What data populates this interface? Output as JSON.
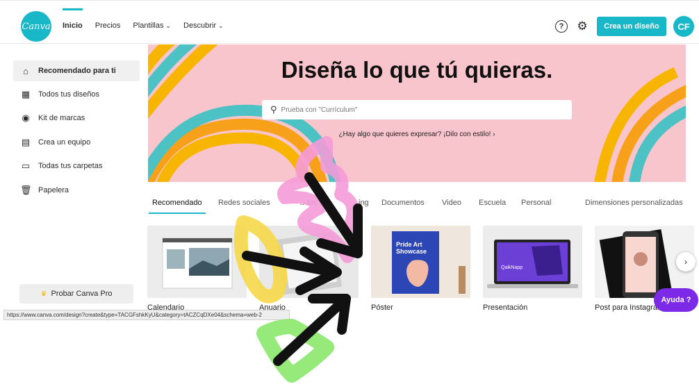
{
  "header": {
    "logo_text": "Canva",
    "nav": [
      {
        "label": "Inicio"
      },
      {
        "label": "Precios"
      },
      {
        "label": "Plantillas",
        "has_dropdown": true
      },
      {
        "label": "Descubrir",
        "has_dropdown": true
      }
    ],
    "create_button": "Crea un diseño",
    "avatar_initials": "CF",
    "help_icon": "?"
  },
  "sidebar": {
    "items": [
      {
        "label": "Recomendado para ti",
        "icon": "home-icon"
      },
      {
        "label": "Todos tus diseños",
        "icon": "grid-icon"
      },
      {
        "label": "Kit de marcas",
        "icon": "brand-kit-icon"
      },
      {
        "label": "Crea un equipo",
        "icon": "team-icon"
      },
      {
        "label": "Todas tus carpetas",
        "icon": "folder-icon"
      },
      {
        "label": "Papelera",
        "icon": "trash-icon"
      }
    ],
    "pro_button": "Probar Canva Pro"
  },
  "hero": {
    "title": "Diseña lo que tú quieras.",
    "search_placeholder": "Prueba con \"Currículum\"",
    "link": "¿Hay algo que quieres expresar? ¡Dilo con estilo! ›"
  },
  "tabs": [
    {
      "label": "Recomendado"
    },
    {
      "label": "Redes sociales"
    },
    {
      "label": "…tos"
    },
    {
      "label": "…ing"
    },
    {
      "label": "Documentos"
    },
    {
      "label": "Video"
    },
    {
      "label": "Escuela"
    },
    {
      "label": "Personal"
    },
    {
      "label": "Dimensiones personalizadas"
    }
  ],
  "cards": [
    {
      "label": "Calendario"
    },
    {
      "label": "Anuario"
    },
    {
      "label": "Póster",
      "image_text": "Pride Art Showcase"
    },
    {
      "label": "Presentación",
      "image_text": "QaikNapp"
    },
    {
      "label": "Post para Instagram"
    }
  ],
  "help_fab": "Ayuda  ?",
  "status_url": "https://www.canva.com/design?create&type=TACGFshkKyU&category=tACZCqDXe04&schema=web-2",
  "colors": {
    "accent": "#18b8c9",
    "hero_bg": "#f9c5cc",
    "help_fab": "#7d2ae8"
  }
}
